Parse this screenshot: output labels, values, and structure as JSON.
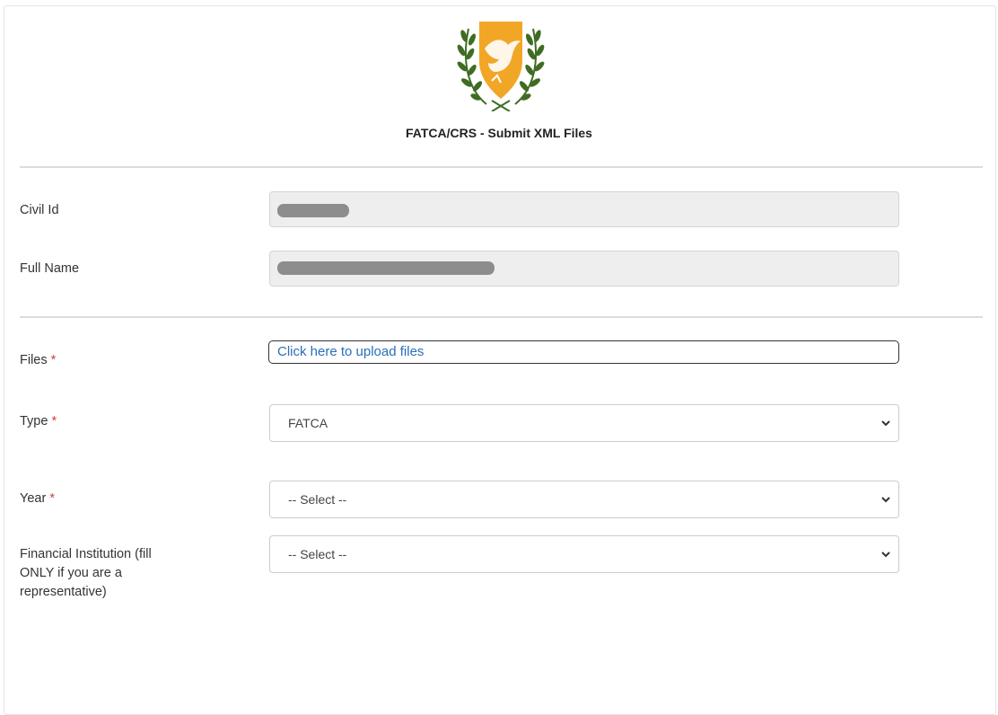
{
  "header": {
    "title": "FATCA/CRS - Submit XML Files",
    "emblem_icon": "cyprus-coat-of-arms-icon"
  },
  "personal": {
    "civil_id_label": "Civil Id",
    "full_name_label": "Full Name"
  },
  "form": {
    "required_mark": "*",
    "files_label": "Files",
    "upload_text": "Click here to upload files",
    "type_label": "Type",
    "type_value": "FATCA",
    "year_label": "Year",
    "year_value": "-- Select --",
    "fi_label_line1": "Financial Institution (fill",
    "fi_label_line2": "ONLY if you are a",
    "fi_label_line3": "representative)",
    "fi_value": "-- Select --"
  },
  "colors": {
    "shield": "#f2a626",
    "olive": "#3f6c22",
    "link": "#2a6fba",
    "required": "#d43f3a"
  }
}
